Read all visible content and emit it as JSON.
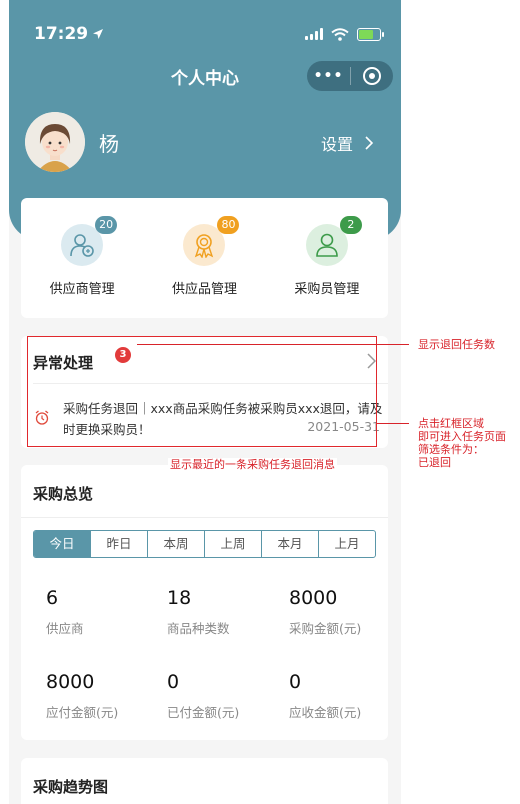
{
  "status": {
    "time": "17:29"
  },
  "nav": {
    "title": "个人中心",
    "more": "•••"
  },
  "profile": {
    "name": "杨",
    "settings": "设置"
  },
  "management": [
    {
      "label": "供应商管理",
      "count": "20",
      "color": "#5a96a8"
    },
    {
      "label": "供应品管理",
      "count": "80",
      "color": "#f0a020"
    },
    {
      "label": "采购员管理",
      "count": "2",
      "color": "#3d9b4a"
    }
  ],
  "abnormal": {
    "title": "异常处理",
    "count": "3",
    "message": "采购任务退回｜xxx商品采购任务被采购员xxx退回，请及时更换采购员！",
    "date": "2021-05-31"
  },
  "overview": {
    "title": "采购总览",
    "tabs": [
      "今日",
      "昨日",
      "本周",
      "上周",
      "本月",
      "上月"
    ],
    "active_tab": "今日",
    "stats": [
      {
        "value": "6",
        "label": "供应商"
      },
      {
        "value": "18",
        "label": "商品种类数"
      },
      {
        "value": "8000",
        "label": "采购金额(元)"
      },
      {
        "value": "8000",
        "label": "应付金额(元)"
      },
      {
        "value": "0",
        "label": "已付金额(元)"
      },
      {
        "value": "0",
        "label": "应收金额(元)"
      }
    ]
  },
  "trend": {
    "title": "采购趋势图"
  },
  "annotations": {
    "count_note": "显示退回任务数",
    "region_note_1": "点击红框区域",
    "region_note_2": "即可进入任务页面",
    "region_note_3": "筛选条件为：",
    "region_note_4": "已退回",
    "bottom_note": "显示最近的一条采购任务退回消息"
  }
}
